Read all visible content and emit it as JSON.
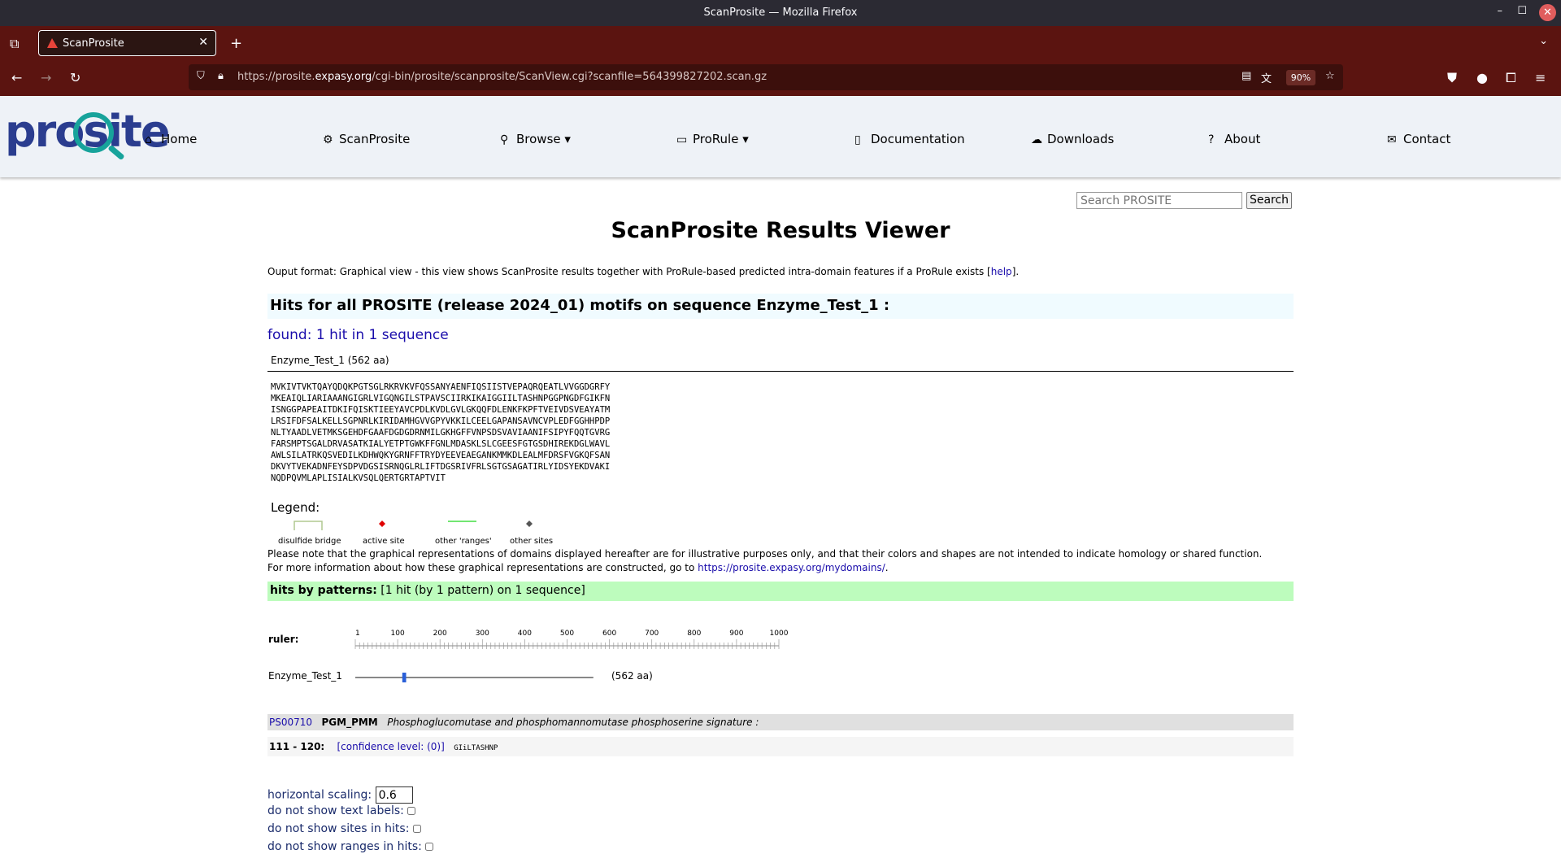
{
  "window": {
    "title": "ScanProsite — Mozilla Firefox"
  },
  "tab": {
    "label": "ScanProsite"
  },
  "urlbar": {
    "url_prefix": "https://prosite.",
    "url_domain": "expasy.org",
    "url_path": "/cgi-bin/prosite/scanprosite/ScanView.cgi?scanfile=564399827202.scan.gz",
    "zoom": "90%"
  },
  "nav": {
    "home": "Home",
    "scanprosite": "ScanProsite",
    "browse": "Browse",
    "prorule": "ProRule",
    "documentation": "Documentation",
    "downloads": "Downloads",
    "about": "About",
    "contact": "Contact"
  },
  "logo": {
    "text": "prosite"
  },
  "search": {
    "placeholder": "Search PROSITE",
    "button": "Search"
  },
  "page": {
    "title": "ScanProsite Results Viewer",
    "output_format": "Ouput format: Graphical view - this view shows ScanProsite results together with ProRule-based predicted intra-domain features if a ProRule exists [",
    "help_link": "help",
    "output_format_end": "].",
    "hits_heading": "Hits for all PROSITE (release 2024_01) motifs on sequence Enzyme_Test_1 :",
    "found": "found: 1 hit in 1 sequence",
    "seq_name": "Enzyme_Test_1 (562 aa)"
  },
  "sequence_lines": [
    "MVKIVTVKTQAYQDQKPGTSGLRKRVKVFQSSANYAENFIQSIISTVEPAQRQEATLVVGGDGRFY",
    "MKEAIQLIARIAAANGIGRLVIGQNGILSTPAVSCIIRKIKAIGGIILTASHNPGGPNGDFGIKFN",
    "ISNGGPAPEAITDKIFQISKTIEEYAVCPDLKVDLGVLGKQQFDLENKFKPFTVEIVDSVEAYATM",
    "LRSIFDFSALKELLSGPNRLKIRIDAMHGVVGPYVKKILCEELGAPANSAVNCVPLEDFGGHHPDP",
    "NLTYAADLVETMKSGEHDFGAAFDGDGDRNMILGKHGFFVNPSDSVAVIAANIFSIPYFQQTGVRG",
    "FARSMPTSGALDRVASATKIALYETPTGWKFFGNLMDASKLSLCGEESFGTGSDHIREKDGLWAVL",
    "AWLSILATRKQSVEDILKDHWQKYGRNFFTRYDYEEVEAEGANKMMKDLEALMFDRSFVGKQFSAN",
    "DKVYTVEKADNFEYSDPVDGSISRNQGLRLIFTDGSRIVFRLSGTGSAGATIRLYIDSYEKDVAKI",
    "NQDPQVMLAPLISIALKVSQLQERTGRTAPTVIT"
  ],
  "legend": {
    "label": "Legend:",
    "items": [
      {
        "label": "disulfide bridge",
        "color": "#b0c890"
      },
      {
        "label": "active site",
        "color": "#e00000"
      },
      {
        "label": "other 'ranges'",
        "color": "#44dd44"
      },
      {
        "label": "other sites",
        "color": "#555555"
      }
    ]
  },
  "notes": {
    "line1": "Please note that the graphical representations of domains displayed hereafter are for illustrative purposes only, and that their colors and shapes are not intended to indicate homology or shared function.",
    "line2_prefix": "For more information about how these graphical representations are constructed, go to ",
    "line2_link": "https://prosite.expasy.org/mydomains/",
    "line2_suffix": "."
  },
  "patterns": {
    "label": "hits by patterns:",
    "summary": "[1 hit (by 1 pattern) on 1 sequence]"
  },
  "ruler": {
    "label": "ruler:",
    "ticks": [
      "1",
      "100",
      "200",
      "300",
      "400",
      "500",
      "600",
      "700",
      "800",
      "900",
      "1000"
    ],
    "max": 1000
  },
  "track": {
    "name": "Enzyme_Test_1",
    "length_label": "(562 aa)",
    "length": 562,
    "hit_start": 111,
    "hit_end": 120
  },
  "hit": {
    "accession": "PS00710",
    "id": "PGM_PMM",
    "description": "Phosphoglucomutase and phosphomannomutase phosphoserine signature :",
    "range": "111 - 120:",
    "confidence": "[confidence level: (0)]",
    "motif": "GIiLTASHNP"
  },
  "options": {
    "hscale_label": "horizontal scaling:",
    "hscale_value": "0.6",
    "no_text_labels": "do not show text labels:",
    "no_sites": "do not show sites in hits:",
    "no_ranges": "do not show ranges in hits:"
  },
  "colors": {
    "tabbar": "#5b1410",
    "hits_bg": "#f0fbff",
    "patterns_bg": "#bdfcbd",
    "hit_marker": "#2a5fd8"
  }
}
